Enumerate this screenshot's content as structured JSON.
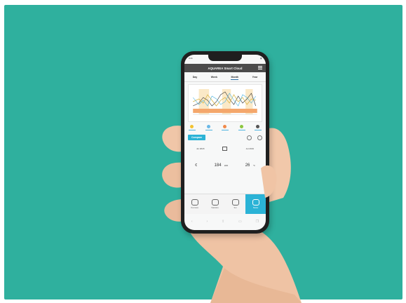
{
  "photo": {
    "background_color": "#2fb09e",
    "subject": "hand holding smartphone"
  },
  "phone": {
    "status_time": "9:41",
    "app_title": "AQUAREA Smart Cloud",
    "tabs": [
      {
        "label": "Day",
        "active": false
      },
      {
        "label": "Week",
        "active": false
      },
      {
        "label": "Month",
        "active": true
      },
      {
        "label": "Year",
        "active": false
      }
    ],
    "compare_label": "Compare",
    "date_from": "Jul 2018",
    "date_to": "Jul 2019",
    "currency": "€",
    "energy_value": "184",
    "energy_unit": "kWh",
    "temp_value": "26",
    "temp_unit": "°C",
    "bottom_nav": [
      "Overview",
      "Statistics",
      "Set",
      "Status"
    ],
    "accent_color": "#2bb3d6",
    "appbar_color": "#4b4b4b"
  }
}
